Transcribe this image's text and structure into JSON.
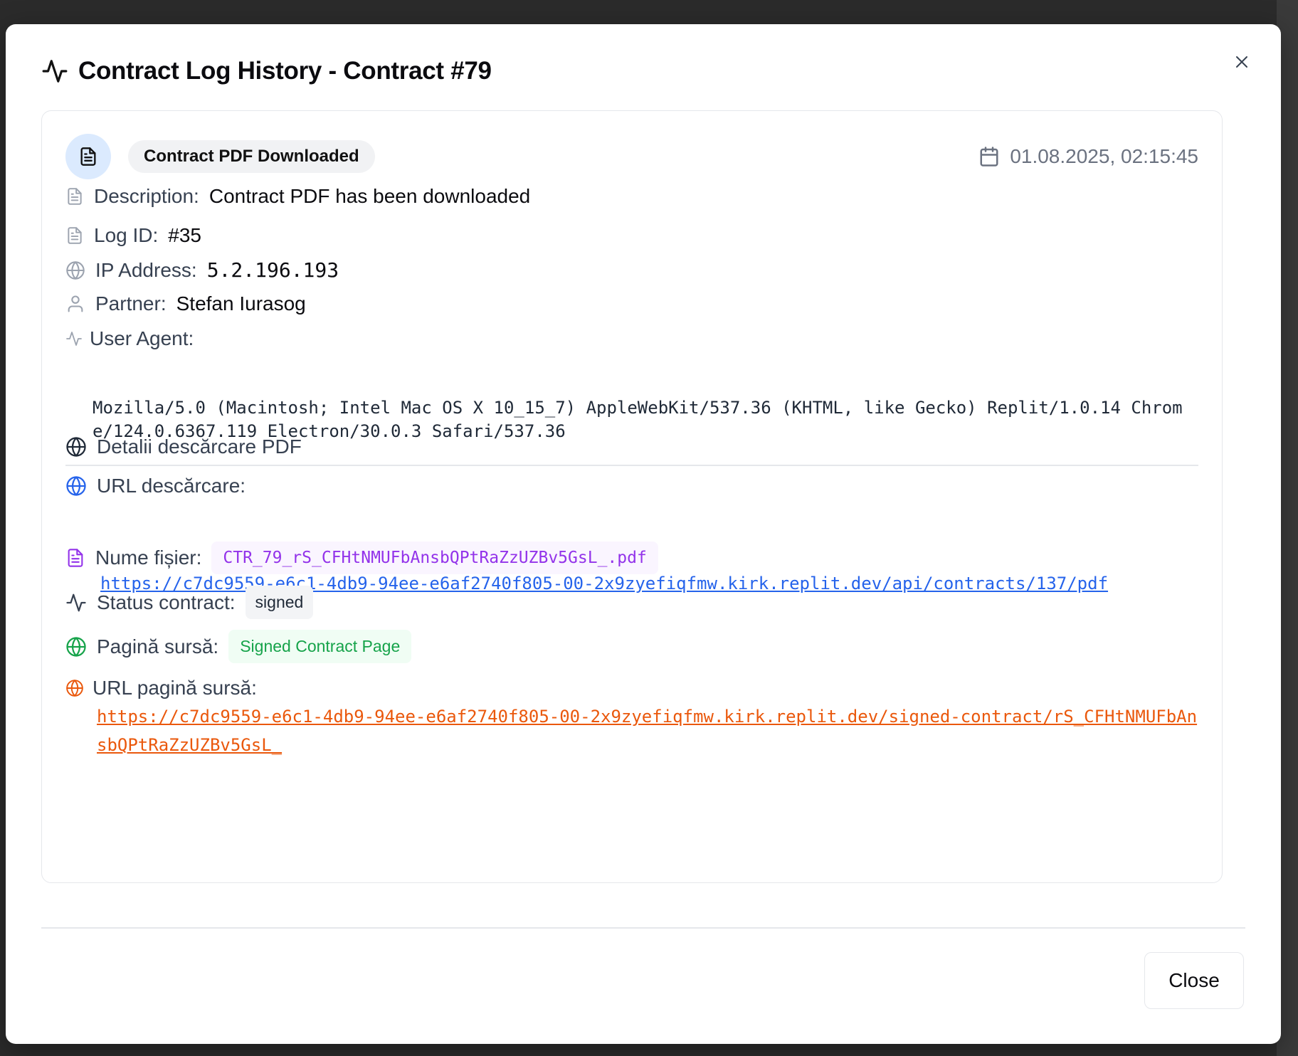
{
  "modal": {
    "title": "Contract Log History - Contract #79",
    "close_button_label": "Close"
  },
  "event": {
    "type_badge": "Contract PDF Downloaded",
    "date": "01.08.2025, 02:15:45"
  },
  "fields": {
    "description_label": "Description:",
    "description_value": "Contract PDF has been downloaded",
    "log_id_label": "Log ID:",
    "log_id_value": "#35",
    "ip_label": "IP Address:",
    "ip_value": "5.2.196.193",
    "partner_label": "Partner:",
    "partner_value": "Stefan Iurasog",
    "user_agent_label": "User Agent:",
    "user_agent_value": "Mozilla/5.0 (Macintosh; Intel Mac OS X 10_15_7) AppleWebKit/537.36 (KHTML, like Gecko) Replit/1.0.14 Chrome/124.0.6367.119 Electron/30.0.3 Safari/537.36"
  },
  "pdf_details": {
    "section_title": "Detalii descărcare PDF",
    "download_url_label": "URL descărcare:",
    "download_url": "https://c7dc9559-e6c1-4db9-94ee-e6af2740f805-00-2x9zyefiqfmw.kirk.replit.dev/api/contracts/137/pdf",
    "filename_label": "Nume fișier:",
    "filename": "CTR_79_rS_CFHtNMUFbAnsbQPtRaZzUZBv5GsL_.pdf",
    "status_label": "Status contract:",
    "status": "signed",
    "source_page_label": "Pagină sursă:",
    "source_page": "Signed Contract Page",
    "source_url_label": "URL pagină sursă:",
    "source_url": "https://c7dc9559-e6c1-4db9-94ee-e6af2740f805-00-2x9zyefiqfmw.kirk.replit.dev/signed-contract/rS_CFHtNMUFbAnsbQPtRaZzUZBv5GsL_"
  },
  "colors": {
    "link_blue": "#2563eb",
    "link_orange": "#ea580c",
    "purple": "#9333ea",
    "green": "#16a34a",
    "icon_circle_bg": "#dbeafe"
  },
  "icons": {
    "title": "activity-icon",
    "event": "file-text-icon",
    "date": "calendar-icon",
    "description": "file-text-icon",
    "log_id": "file-text-icon",
    "ip": "globe-icon",
    "partner": "user-icon",
    "user_agent": "activity-icon",
    "section": "globe-icon",
    "download_url": "globe-icon",
    "filename": "file-text-icon",
    "status": "activity-icon",
    "source_page": "globe-icon",
    "source_url": "globe-icon",
    "close": "x-icon"
  }
}
